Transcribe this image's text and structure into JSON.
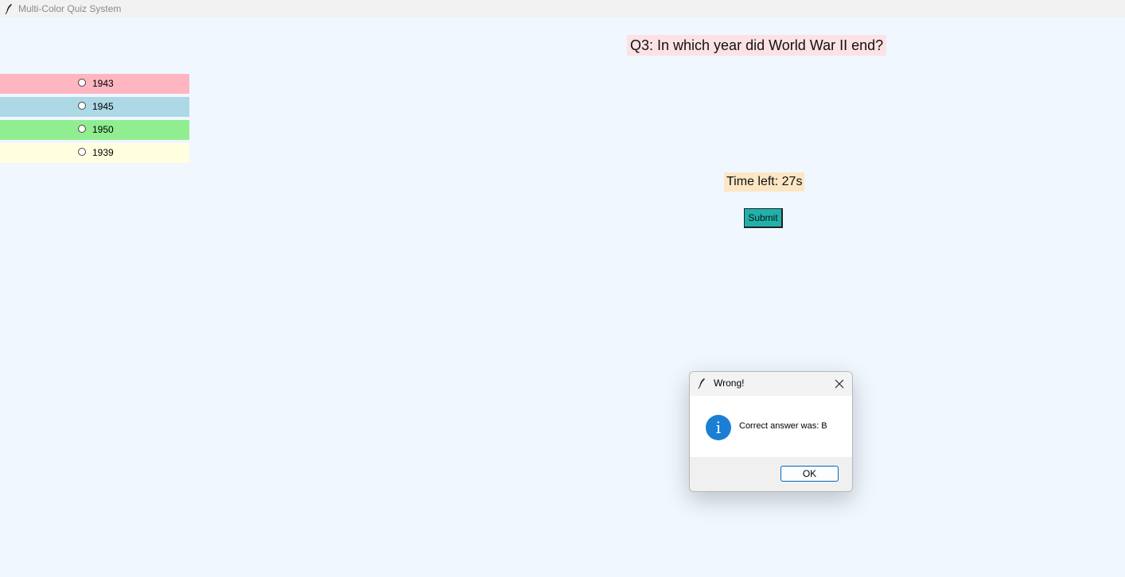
{
  "window": {
    "title": "Multi-Color Quiz System"
  },
  "quiz": {
    "question": "Q3: In which year did World War II end?",
    "options": [
      {
        "label": "1943",
        "color": "#ffb6c1",
        "selected": false
      },
      {
        "label": "1945",
        "color": "#add8e6",
        "selected": false
      },
      {
        "label": "1950",
        "color": "#90ee90",
        "selected": false
      },
      {
        "label": "1939",
        "color": "#ffffe0",
        "selected": false
      }
    ],
    "timer": "Time left: 27s",
    "submit_label": "Submit"
  },
  "dialog": {
    "title": "Wrong!",
    "message": "Correct answer was: B",
    "ok_label": "OK",
    "icon": "info-icon"
  },
  "colors": {
    "background": "#f0f7ff",
    "question_bg": "#fde2e4",
    "timer_bg": "#fde6c4",
    "submit_bg": "#20b2aa",
    "info_blue": "#1a7fd4"
  }
}
